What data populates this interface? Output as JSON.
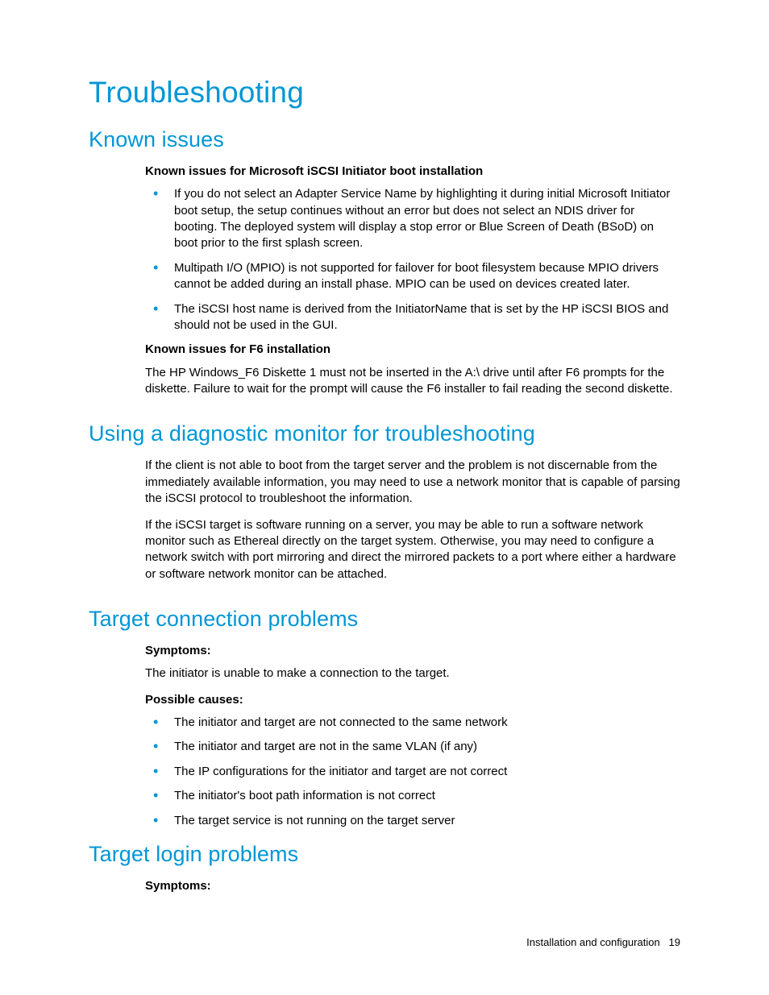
{
  "title": "Troubleshooting",
  "sections": {
    "known_issues": {
      "heading": "Known issues",
      "sub1": "Known issues for Microsoft iSCSI Initiator boot installation",
      "bullets1": [
        "If you do not select an Adapter Service Name by highlighting it during initial Microsoft Initiator boot setup, the setup continues without an error but does not select an NDIS driver for booting. The deployed system will display a stop error or Blue Screen of Death (BSoD) on boot prior to the first splash screen.",
        "Multipath I/O (MPIO) is not supported for failover for boot filesystem because MPIO drivers cannot be added during an install phase. MPIO can be used on devices created later.",
        "The iSCSI host name is derived from the InitiatorName that is set by the HP iSCSI BIOS and should not be used in the GUI."
      ],
      "sub2": "Known issues for F6 installation",
      "para2": "The HP Windows_F6 Diskette 1 must not be inserted in the A:\\ drive until after F6 prompts for the diskette. Failure to wait for the prompt will cause the F6 installer to fail reading the second diskette."
    },
    "diagnostic": {
      "heading": "Using a diagnostic monitor for troubleshooting",
      "para1": "If the client is not able to boot from the target server and the problem is not discernable from the immediately available information, you may need to use a network monitor that is capable of parsing the iSCSI protocol to troubleshoot the information.",
      "para2": "If the iSCSI target is software running on a server, you may be able to run a software network monitor such as Ethereal directly on the target system. Otherwise, you may need to configure a network switch with port mirroring and direct the mirrored packets to a port where either a hardware or software network monitor can be attached."
    },
    "connection": {
      "heading": "Target connection problems",
      "symptoms_label": "Symptoms:",
      "symptoms_text": "The initiator is unable to make a connection to the target.",
      "causes_label": "Possible causes:",
      "causes": [
        "The initiator and target are not connected to the same network",
        "The initiator and target are not in the same VLAN (if any)",
        "The IP configurations for the initiator and target are not correct",
        "The initiator's boot path information is not correct",
        "The target service is not running on the target server"
      ]
    },
    "login": {
      "heading": "Target login problems",
      "symptoms_label": "Symptoms:"
    }
  },
  "footer": {
    "text": "Installation and configuration",
    "page": "19"
  }
}
